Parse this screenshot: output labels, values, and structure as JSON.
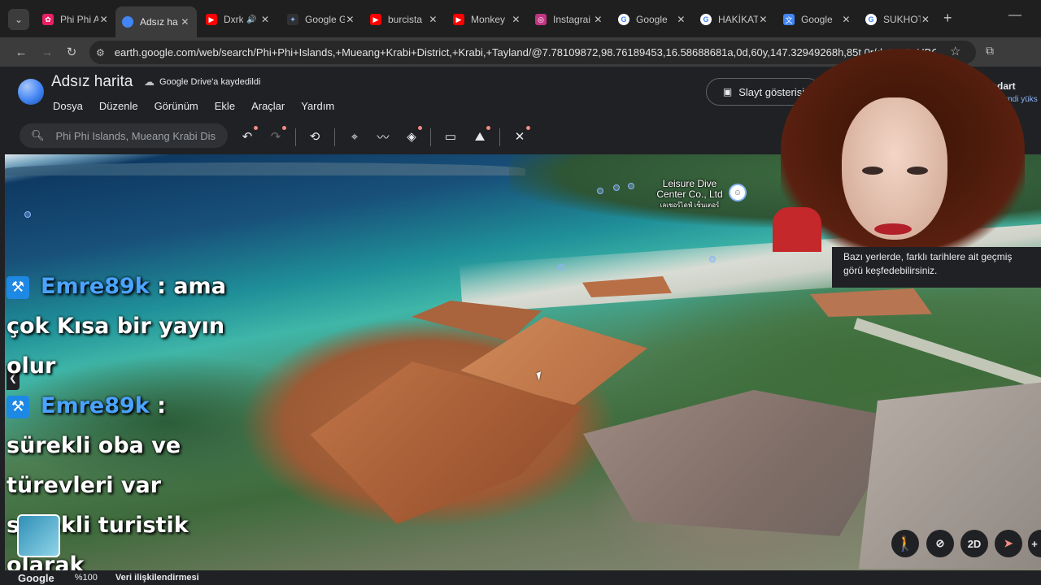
{
  "browser": {
    "tabs": [
      {
        "title": "Phi Phi A",
        "favicon_color": "#e91e63",
        "favicon": "✿",
        "active": false
      },
      {
        "title": "Adsız ha",
        "favicon_color": "#4285f4",
        "favicon": "●",
        "active": true
      },
      {
        "title": "Dxrk",
        "favicon_color": "#ff0000",
        "favicon": "▶",
        "active": false,
        "audio": "🔊"
      },
      {
        "title": "Google G",
        "favicon_color": "#303134",
        "favicon": "✦",
        "active": false
      },
      {
        "title": "burcista",
        "favicon_color": "#ff0000",
        "favicon": "▶",
        "active": false
      },
      {
        "title": "Monkey",
        "favicon_color": "#ff0000",
        "favicon": "▶",
        "active": false
      },
      {
        "title": "Instagrai",
        "favicon_color": "#c13584",
        "favicon": "◎",
        "active": false
      },
      {
        "title": "Google",
        "favicon_color": "#ffffff",
        "favicon": "G",
        "active": false
      },
      {
        "title": "HAKİKAT",
        "favicon_color": "#ffffff",
        "favicon": "G",
        "active": false
      },
      {
        "title": "Google",
        "favicon_color": "#4285f4",
        "favicon": "文",
        "active": false
      },
      {
        "title": "SUKHOT",
        "favicon_color": "#ffffff",
        "favicon": "G",
        "active": false
      }
    ],
    "url": "earth.google.com/web/search/Phi+Phi+Islands,+Mueang+Krabi+District,+Krabi,+Tayland/@7.78109872,98.76189453,16.58688681a,0d,60y,147.32949268h,85t,0r/data=CqUBGi..."
  },
  "earth": {
    "title": "Adsız harita",
    "saved_status": "Google Drive'a kaydedildi",
    "menu": [
      "Dosya",
      "Düzenle",
      "Görünüm",
      "Ekle",
      "Araçlar",
      "Yardım"
    ],
    "slideshow_label": "Slayt gösterisi",
    "map_style": "Standart",
    "map_style_sub": "ilanı şimdi yüks",
    "search_value": "Phi Phi Islands, Mueang Krabi Dis",
    "poi_name": "Leisure Dive Center Co., Ltd",
    "poi_thai": "เลเชอร์ไดฟ์ เซ็นเตอร์",
    "tooltip": "Bazı yerlerde, farklı tarihlere ait geçmiş görü keşfedebilirsiniz.",
    "controls": {
      "pegman": "🚶",
      "tilt": "⊘",
      "view_2d": "2D",
      "compass": "➤"
    },
    "footer": {
      "brand": "Google",
      "zoom": "%100",
      "data_link": "Veri ilişkilendirmesi"
    }
  },
  "chat": [
    {
      "user": "Emre89k",
      "message": ": ama çok Kısa bir yayın olur"
    },
    {
      "user": "Emre89k",
      "message": ": sürekli oba ve türevleri var sürekli turistik olarak"
    }
  ],
  "colors": {
    "accent": "#8ab4f8",
    "chat_user": "#4aa3ff",
    "brand_blue": "#4285f4"
  }
}
